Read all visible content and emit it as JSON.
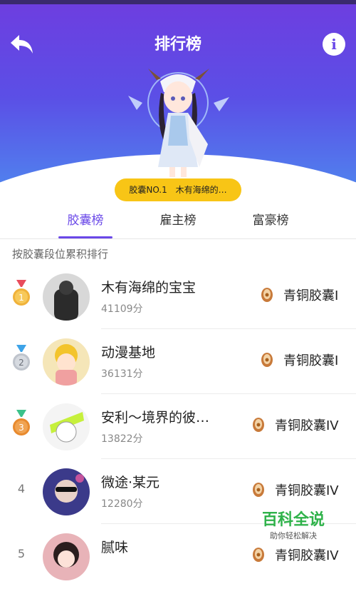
{
  "header": {
    "title": "排行榜"
  },
  "badge": {
    "label": "胶囊NO.1",
    "name": "木有海绵的…"
  },
  "tabs": [
    {
      "label": "胶囊榜",
      "active": true
    },
    {
      "label": "雇主榜",
      "active": false
    },
    {
      "label": "富豪榜",
      "active": false
    }
  ],
  "subtitle": "按胶囊段位累积排行",
  "rows": [
    {
      "rank": "1",
      "name": "木有海绵的宝宝",
      "score": "41109分",
      "tier": "青铜胶囊I"
    },
    {
      "rank": "2",
      "name": "动漫基地",
      "score": "36131分",
      "tier": "青铜胶囊I"
    },
    {
      "rank": "3",
      "name": "安利～境界的彼…",
      "score": "13822分",
      "tier": "青铜胶囊IV"
    },
    {
      "rank": "4",
      "name": "微途·某元",
      "score": "12280分",
      "tier": "青铜胶囊IV"
    },
    {
      "rank": "5",
      "name": "腻味",
      "score": "",
      "tier": "青铜胶囊IV"
    }
  ],
  "watermark": {
    "title": "百科全说",
    "subtitle": "助你轻松解决"
  },
  "colors": {
    "accent": "#6a48e8",
    "badge": "#f8c516",
    "gold": "#f0b23a",
    "silver": "#bfc4cc",
    "bronze": "#e88a2e"
  },
  "icons": {
    "back": "back-arrow-icon",
    "info": "info-icon",
    "tier": "capsule-icon"
  }
}
